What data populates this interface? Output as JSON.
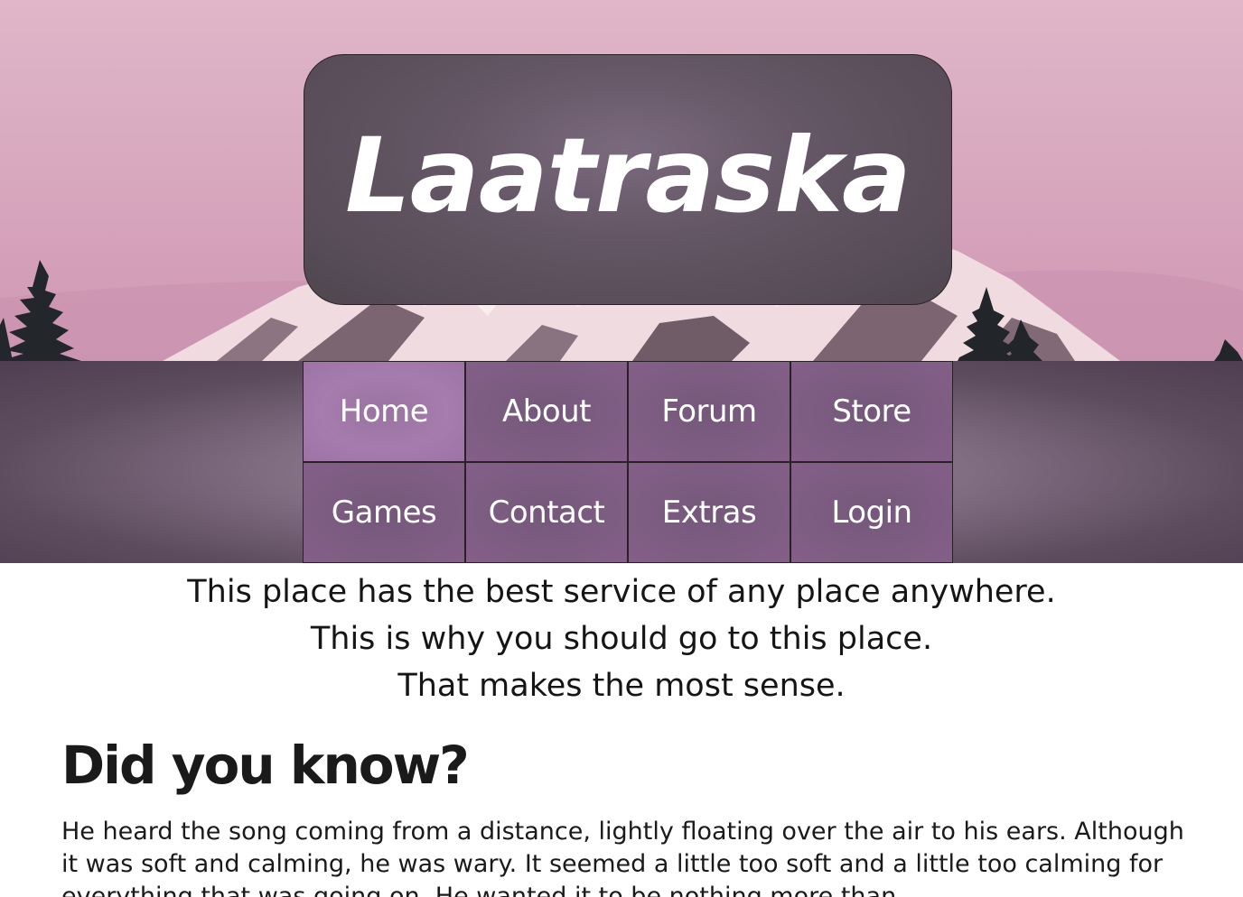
{
  "site": {
    "title": "Laatraska"
  },
  "nav": {
    "items": [
      {
        "label": "Home",
        "active": true
      },
      {
        "label": "About",
        "active": false
      },
      {
        "label": "Forum",
        "active": false
      },
      {
        "label": "Store",
        "active": false
      },
      {
        "label": "Games",
        "active": false
      },
      {
        "label": "Contact",
        "active": false
      },
      {
        "label": "Extras",
        "active": false
      },
      {
        "label": "Login",
        "active": false
      }
    ]
  },
  "intro": {
    "lines": [
      "This place has the best service of any place anywhere.",
      "This is why you should go to this place.",
      "That makes the most sense."
    ]
  },
  "section": {
    "heading": "Did you know?",
    "body": "He heard the song coming from a distance, lightly floating over the air to his ears. Although it was soft and calming, he was wary. It seemed a little too soft and a little too calming for everything that was going on. He wanted it to be nothing more than"
  },
  "colors": {
    "sky_top": "#e0b6c8",
    "sky_bottom": "#cf9cb5",
    "title_box": "#655766",
    "nav_band": "#5d4b5e",
    "nav_cell": "#7b5c80",
    "nav_active": "#a57cad",
    "text": "#151515"
  }
}
